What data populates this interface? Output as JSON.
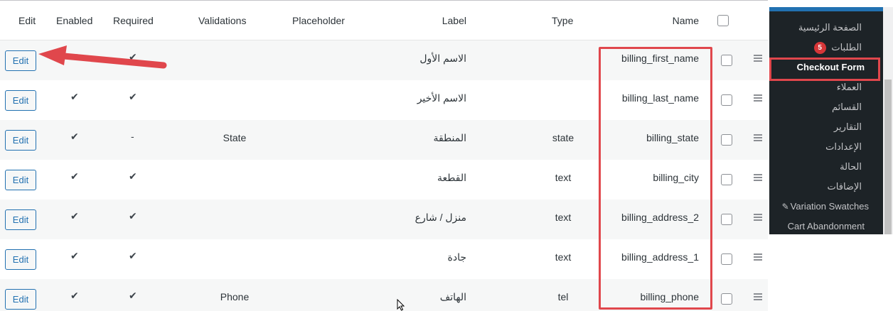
{
  "table": {
    "headers": {
      "edit": "Edit",
      "enabled": "Enabled",
      "required": "Required",
      "validations": "Validations",
      "placeholder": "Placeholder",
      "label": "Label",
      "type": "Type",
      "name": "Name"
    },
    "rows": [
      {
        "edit": "Edit",
        "enabled": "✔",
        "required": "✔",
        "validations": "",
        "placeholder": "",
        "label": "الاسم الأول",
        "type": "",
        "name": "billing_first_name"
      },
      {
        "edit": "Edit",
        "enabled": "✔",
        "required": "✔",
        "validations": "",
        "placeholder": "",
        "label": "الاسم الأخير",
        "type": "",
        "name": "billing_last_name"
      },
      {
        "edit": "Edit",
        "enabled": "✔",
        "required": "-",
        "validations": "State",
        "placeholder": "",
        "label": "المنطقة",
        "type": "state",
        "name": "billing_state"
      },
      {
        "edit": "Edit",
        "enabled": "✔",
        "required": "✔",
        "validations": "",
        "placeholder": "",
        "label": "القطعة",
        "type": "text",
        "name": "billing_city"
      },
      {
        "edit": "Edit",
        "enabled": "✔",
        "required": "✔",
        "validations": "",
        "placeholder": "",
        "label": "منزل / شارع",
        "type": "text",
        "name": "billing_address_2"
      },
      {
        "edit": "Edit",
        "enabled": "✔",
        "required": "✔",
        "validations": "",
        "placeholder": "",
        "label": "جادة",
        "type": "text",
        "name": "billing_address_1"
      },
      {
        "edit": "Edit",
        "enabled": "✔",
        "required": "✔",
        "validations": "Phone",
        "placeholder": "",
        "label": "الهاتف",
        "type": "tel",
        "name": "billing_phone"
      }
    ]
  },
  "sidebar": {
    "items": [
      {
        "label": "الصفحة الرئيسية"
      },
      {
        "label": "الطلبات",
        "badge": "5"
      },
      {
        "label": "Checkout Form",
        "active": true
      },
      {
        "label": "العملاء"
      },
      {
        "label": "القسائم"
      },
      {
        "label": "التقارير"
      },
      {
        "label": "الإعدادات"
      },
      {
        "label": "الحالة"
      },
      {
        "label": "الإضافات"
      },
      {
        "label": "Variation Swatches",
        "icon": "swatch-icon"
      },
      {
        "label": "Cart Abandonment"
      }
    ]
  },
  "colors": {
    "highlight": "#e0474c",
    "sidebar_bg": "#1d2327",
    "button_accent": "#2271b1"
  }
}
